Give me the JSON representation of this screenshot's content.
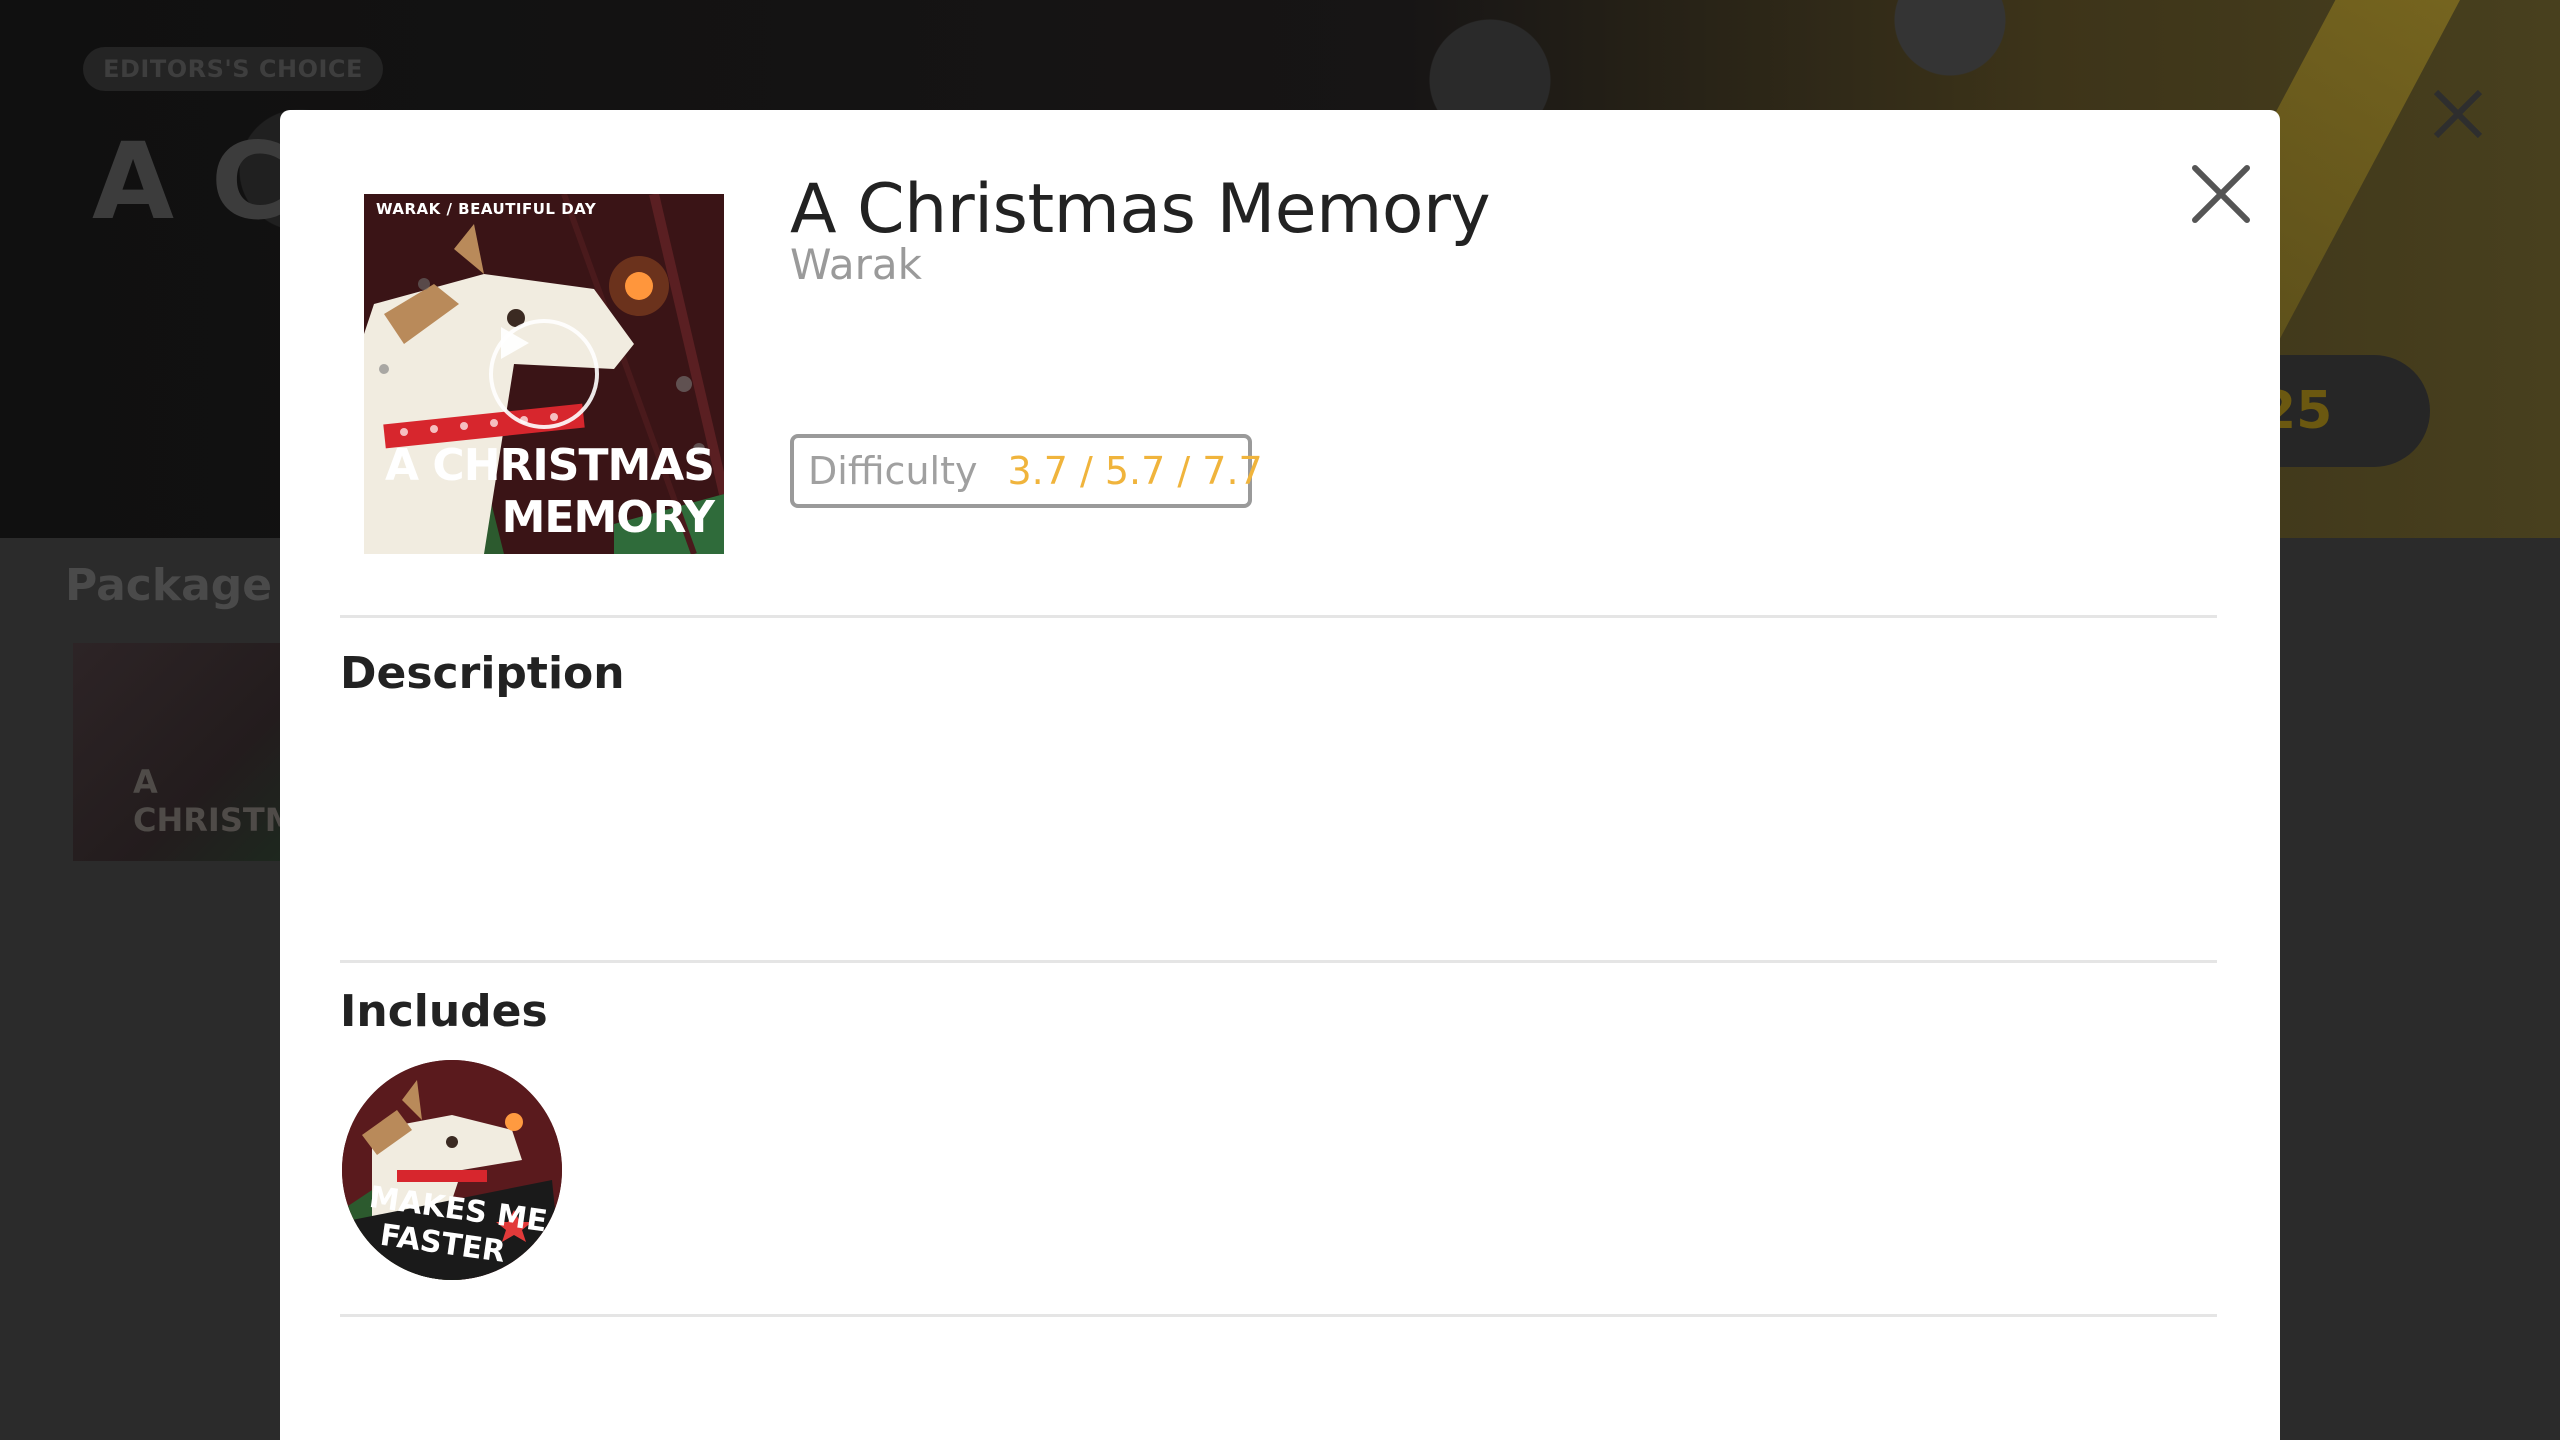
{
  "background": {
    "badge": "EDITORS'S CHOICE",
    "title": "A Ch",
    "pill_value": "25",
    "section_label": "Package li",
    "thumb_text": "A CHRISTMA"
  },
  "modal": {
    "title": "A Christmas Memory",
    "artist": "Warak",
    "cover": {
      "caption": "WARAK / BEAUTIFUL DAY",
      "title_line1": "A CHRISTMAS",
      "title_line2": "MEMORY"
    },
    "difficulty": {
      "label": "Difficulty",
      "value": "3.7 / 5.7 / 7.7",
      "value_color": "#f0b43c"
    },
    "description": {
      "heading": "Description",
      "text": ""
    },
    "includes": {
      "heading": "Includes",
      "items": [
        {
          "badge_text_line1": "MAKES ME",
          "badge_text_line2": "FASTER"
        }
      ]
    },
    "icons": {
      "close": "close-icon",
      "play": "play-icon"
    }
  }
}
